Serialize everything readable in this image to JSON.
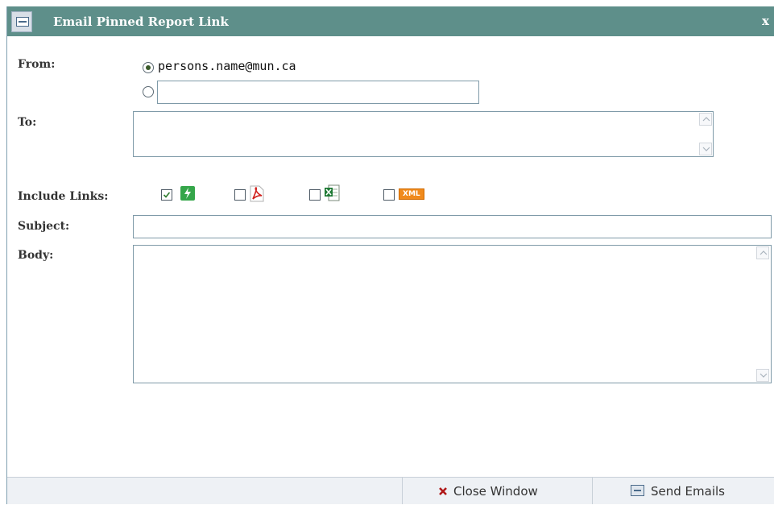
{
  "window": {
    "title": "Email Pinned Report Link",
    "close_label": "x",
    "title_icon": "email-icon"
  },
  "form": {
    "from_label": "From:",
    "from_option_email": "persons.name@mun.ca",
    "from_option_custom_value": "",
    "to_label": "To:",
    "to_value": "",
    "include_links_label": "Include Links:",
    "include_links": [
      {
        "icon": "interactive-report-icon",
        "checked": true
      },
      {
        "icon": "pdf-icon",
        "checked": false
      },
      {
        "icon": "excel-icon",
        "checked": false
      },
      {
        "icon": "xml-icon",
        "checked": false,
        "badge": "XML"
      }
    ],
    "subject_label": "Subject:",
    "subject_value": "",
    "body_label": "Body:",
    "body_value": ""
  },
  "footer": {
    "close_label": "Close Window",
    "send_label": "Send Emails"
  },
  "colors": {
    "titlebar": "#5e8f8a",
    "footer": "#eef1f5",
    "border": "#7f9aa8"
  }
}
